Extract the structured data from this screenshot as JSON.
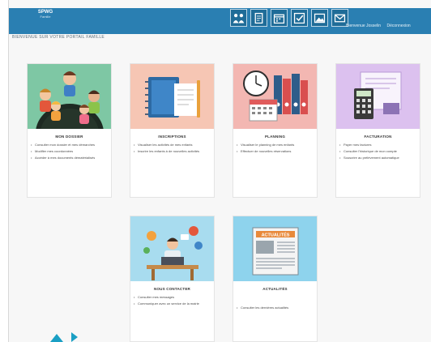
{
  "header": {
    "logo_main": "SPWG",
    "logo_sub": "Famille",
    "welcome_text": "Bienvenue Josselin",
    "logout_text": "Déconnexion",
    "nav_icons": [
      "family-icon",
      "document-icon",
      "calendar-icon",
      "check-icon",
      "photo-icon",
      "mail-icon"
    ]
  },
  "page_title": "BIENVENUE SUR VOTRE PORTAIL FAMILLE",
  "cards": [
    {
      "title": "MON DOSSIER",
      "icon": "children-icon",
      "items": [
        "Consulter mon dossier et mes démarches",
        "Modifier mes coordonnées",
        "Accéder à mes documents dématérialisés"
      ]
    },
    {
      "title": "INSCRIPTIONS",
      "icon": "notebook-icon",
      "items": [
        "Visualiser les activités de mes enfants",
        "Inscrire les enfants à de nouvelles activités"
      ]
    },
    {
      "title": "PLANNING",
      "icon": "clock-calendar-icon",
      "items": [
        "Visualiser le planning de mes enfants",
        "Effectuer de nouvelles réservations"
      ]
    },
    {
      "title": "FACTURATION",
      "icon": "calculator-icon",
      "items": [
        "Payer mes factures",
        "Consulter l'historique de mon compte",
        "Souscrire au prélèvement automatique"
      ]
    },
    {
      "title": "NOUS CONTACTER",
      "icon": "contact-icon",
      "items": [
        "Consulter mes messages",
        "Communiquer avec un service de la mairie"
      ]
    },
    {
      "title": "ACTUALITÉS",
      "icon": "newspaper-icon",
      "illus_text": "ACTUALITÉS",
      "items": [
        "Consulter les dernières actualités"
      ]
    }
  ],
  "colors": {
    "header": "#2a7fb2",
    "card1_bg": "#7ec7a4",
    "card2_bg": "#f6c6b4",
    "card3_bg": "#f3b7b2",
    "card4_bg": "#dcc1ef",
    "card5_bg": "#a8dcef",
    "card6_bg": "#8ed3ed",
    "accent": "#1a9fc4"
  }
}
